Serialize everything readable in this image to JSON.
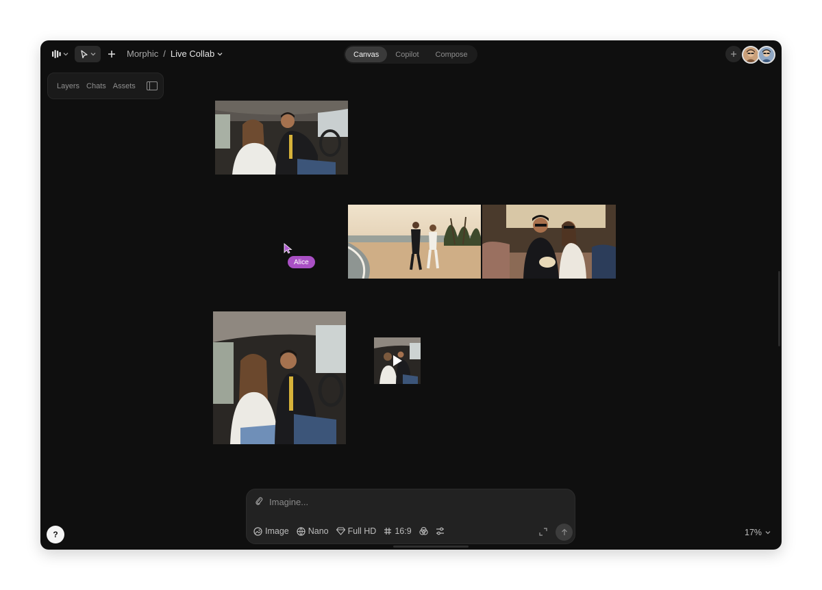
{
  "breadcrumb": {
    "workspace": "Morphic",
    "separator": "/",
    "project": "Live Collab"
  },
  "mode_tabs": [
    "Canvas",
    "Copilot",
    "Compose"
  ],
  "active_mode": "Canvas",
  "panel_tabs": [
    "Layers",
    "Chats",
    "Assets"
  ],
  "collaborator_cursor": {
    "name": "Alice",
    "color": "#a950c4"
  },
  "prompt": {
    "placeholder": "Imagine...",
    "value": "",
    "options": {
      "type": "Image",
      "model": "Nano",
      "resolution": "Full HD",
      "aspect_ratio": "16:9"
    }
  },
  "help_label": "?",
  "zoom": "17%",
  "colors": {
    "canvas_bg": "#0f0f0f",
    "cursor_accent": "#a950c4"
  }
}
